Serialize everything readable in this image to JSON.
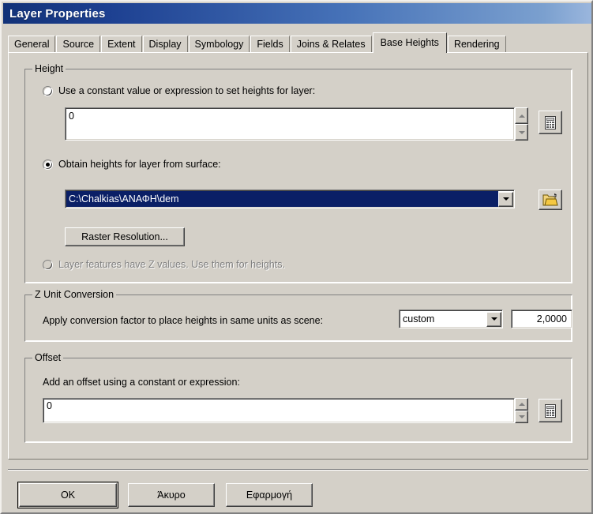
{
  "window": {
    "title": "Layer Properties"
  },
  "tabs": [
    {
      "label": "General",
      "selected": false
    },
    {
      "label": "Source",
      "selected": false
    },
    {
      "label": "Extent",
      "selected": false
    },
    {
      "label": "Display",
      "selected": false
    },
    {
      "label": "Symbology",
      "selected": false
    },
    {
      "label": "Fields",
      "selected": false
    },
    {
      "label": "Joins & Relates",
      "selected": false
    },
    {
      "label": "Base Heights",
      "selected": true
    },
    {
      "label": "Rendering",
      "selected": false
    }
  ],
  "height_group": {
    "legend": "Height",
    "constant_radio_label": "Use a constant value or expression to set heights for layer:",
    "constant_radio_checked": false,
    "constant_value": "0",
    "surface_radio_label": "Obtain heights for layer from surface:",
    "surface_radio_checked": true,
    "surface_value": "C:\\Chalkias\\ΑΝΑΦΗ\\dem",
    "raster_resolution_label": "Raster Resolution...",
    "zvalues_radio_label": "Layer features have Z values.  Use them for heights.",
    "zvalues_radio_checked": false,
    "zvalues_disabled": true
  },
  "zunit_group": {
    "legend": "Z Unit Conversion",
    "description": "Apply conversion factor to place heights in same units as scene:",
    "unit_selected": "custom",
    "factor_value": "2,0000"
  },
  "offset_group": {
    "legend": "Offset",
    "description": "Add an offset using a constant or expression:",
    "offset_value": "0"
  },
  "buttons": {
    "ok": "OK",
    "cancel": "Άκυρο",
    "apply": "Εφαρμογή"
  },
  "icons": {
    "calculator": "calculator-icon",
    "folder_open": "folder-open-icon",
    "spinner_up": "spinner-up-icon",
    "spinner_down": "spinner-down-icon",
    "dropdown": "chevron-down-icon"
  },
  "colors": {
    "face": "#d4d0c8",
    "title_start": "#123278",
    "title_end": "#9ab6dd",
    "selection": "#0a1f66",
    "folder_yellow": "#f0c419"
  }
}
